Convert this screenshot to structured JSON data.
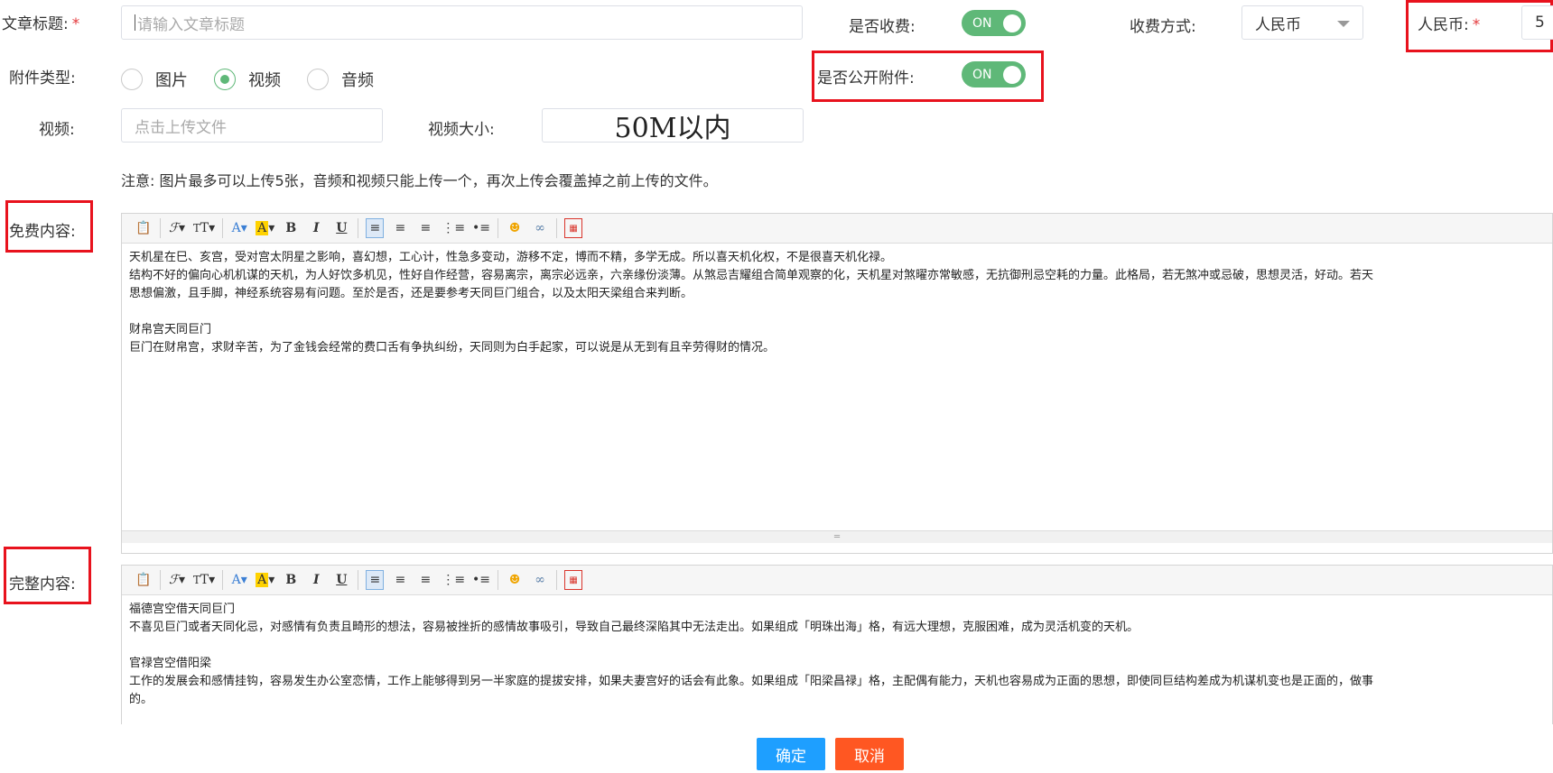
{
  "form": {
    "title_label": "文章标题:",
    "required_mark": "*",
    "title_placeholder": "请输入文章标题",
    "charge_label": "是否收费:",
    "charge_switch": "ON",
    "charge_method_label": "收费方式:",
    "charge_method_value": "人民币",
    "rmb_label": "人民币:",
    "rmb_value": "5",
    "attach_type_label": "附件类型:",
    "attach_types": [
      "图片",
      "视频",
      "音频"
    ],
    "attach_selected": "视频",
    "public_attach_label": "是否公开附件:",
    "public_attach_switch": "ON",
    "video_label": "视频:",
    "upload_placeholder": "点击上传文件",
    "video_size_label": "视频大小:",
    "video_size_value": "50M以内",
    "note": "注意: 图片最多可以上传5张，音频和视频只能上传一个，再次上传会覆盖掉之前上传的文件。"
  },
  "editors": {
    "free_label": "免费内容:",
    "full_label": "完整内容:",
    "toolbar_icons": [
      "paste-icon",
      "font-family-icon",
      "font-size-icon",
      "font-color-icon",
      "highlight-icon",
      "bold-icon",
      "italic-icon",
      "underline-icon",
      "align-left-icon",
      "align-center-icon",
      "align-right-icon",
      "ordered-list-icon",
      "unordered-list-icon",
      "emoji-icon",
      "link-icon",
      "fullscreen-icon"
    ],
    "free_content": [
      "天机星在巳、亥宫，受对宫太阴星之影响，喜幻想，工心计，性急多变动，游移不定，博而不精，多学无成。所以喜天机化权，不是很喜天机化禄。",
      "结构不好的偏向心机机谋的天机，为人好饮多机见，性好自作经营，容易离宗，离宗必远亲，六亲缘份淡薄。从煞忌吉耀组合简单观察的化，天机星对煞曜亦常敏感，无抗御刑忌空耗的力量。此格局，若无煞冲或忌破，思想灵活，好动。若天",
      "思想偏激，且手脚，神经系统容易有问题。至於是否，还是要参考天同巨门组合，以及太阳天梁组合来判断。",
      "",
      "财帛宫天同巨门",
      "巨门在财帛宫，求财辛苦，为了金钱会经常的费口舌有争执纠纷，天同则为白手起家，可以说是从无到有且辛劳得财的情况。"
    ],
    "full_content": [
      "福德宫空借天同巨门",
      "不喜见巨门或者天同化忌，对感情有负责且畸形的想法，容易被挫折的感情故事吸引，导致自己最终深陷其中无法走出。如果组成「明珠出海」格，有远大理想，克服困难，成为灵活机变的天机。",
      "",
      "官禄宫空借阳梁",
      "工作的发展会和感情挂钩，容易发生办公室恋情，工作上能够得到另一半家庭的提拔安排，如果夫妻宫好的话会有此象。如果组成「阳梁昌禄」格，主配偶有能力，天机也容易成为正面的思想，即使同巨结构差成为机谋机变也是正面的，做事",
      "的。"
    ]
  },
  "actions": {
    "confirm": "确定",
    "cancel": "取消",
    "confirm_color": "#1e9fff",
    "cancel_color": "#ff5722"
  },
  "colors": {
    "switch_on": "#5fb878",
    "highlight_box": "#e8121d"
  }
}
